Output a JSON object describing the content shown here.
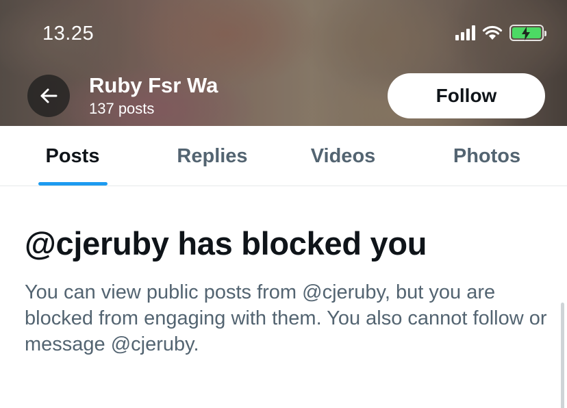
{
  "status_bar": {
    "time": "13.25",
    "icons": [
      "cellular-signal-icon",
      "wifi-icon",
      "battery-charging-icon"
    ],
    "battery_color": "#4cd964"
  },
  "header": {
    "back_icon": "arrow-left-icon",
    "profile_name": "Ruby Fsr Wa",
    "post_count": "137 posts",
    "follow_label": "Follow"
  },
  "tabs": [
    {
      "label": "Posts",
      "active": true
    },
    {
      "label": "Replies",
      "active": false
    },
    {
      "label": "Videos",
      "active": false
    },
    {
      "label": "Photos",
      "active": false
    }
  ],
  "accent_color": "#1d9bf0",
  "blocked": {
    "title": "@cjeruby has blocked you",
    "description": "You can view public posts from @cjeruby, but you are blocked from engaging with them. You also cannot follow or message @cjeruby."
  }
}
